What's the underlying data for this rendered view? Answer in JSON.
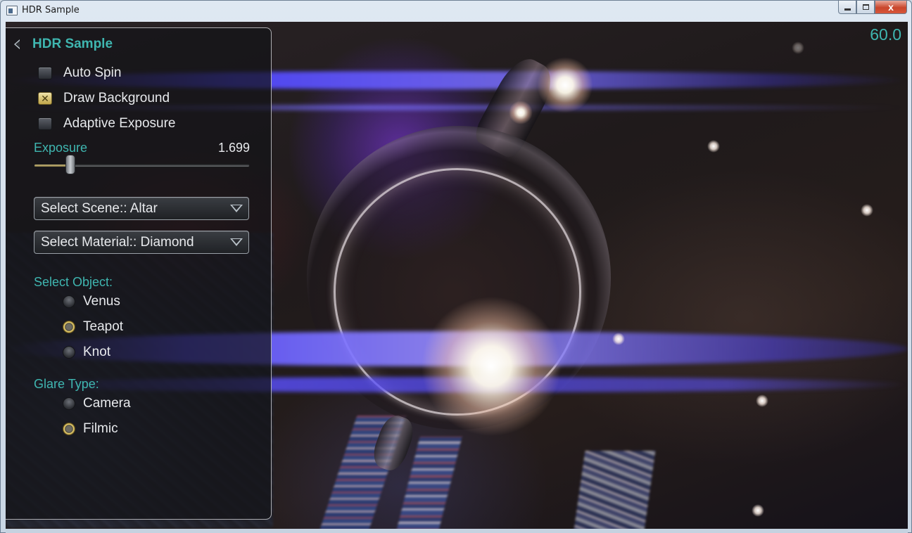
{
  "window": {
    "title": "HDR Sample",
    "buttons": [
      "minimize",
      "maximize",
      "close"
    ],
    "close_glyph": "x"
  },
  "overlay": {
    "fps": "60.0"
  },
  "panel": {
    "title": "HDR Sample",
    "checkboxes": [
      {
        "label": "Auto Spin",
        "checked": false
      },
      {
        "label": "Draw Background",
        "checked": true
      },
      {
        "label": "Adaptive Exposure",
        "checked": false
      }
    ],
    "exposure": {
      "label": "Exposure",
      "value": "1.699",
      "level_fraction": 0.17
    },
    "scene_dropdown": {
      "label": "Select Scene:: Altar"
    },
    "material_dropdown": {
      "label": "Select Material:: Diamond"
    },
    "object_group": {
      "label": "Select Object:",
      "options": [
        {
          "label": "Venus",
          "selected": false
        },
        {
          "label": "Teapot",
          "selected": true
        },
        {
          "label": "Knot",
          "selected": false
        }
      ]
    },
    "glare_group": {
      "label": "Glare Type:",
      "options": [
        {
          "label": "Camera",
          "selected": false
        },
        {
          "label": "Filmic",
          "selected": true
        }
      ]
    }
  },
  "colors": {
    "accent": "#3fb6b0",
    "checked": "#c0a54a",
    "panel_border": "#c8c8cd"
  },
  "icons": {
    "back": "back-arrow-icon",
    "dropdown": "triangle-down-icon",
    "check": "x-check-icon"
  }
}
